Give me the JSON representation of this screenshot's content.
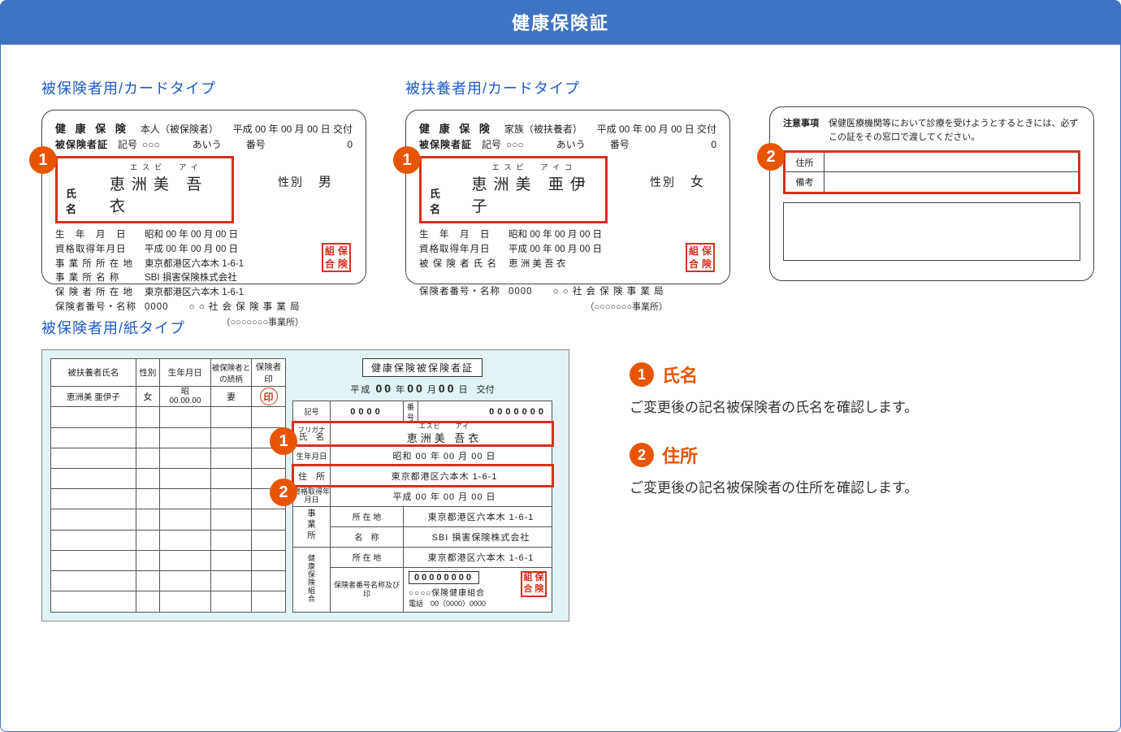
{
  "header": "健康保険証",
  "sec1_label": "被保険者用/カードタイプ",
  "sec2_label": "被扶養者用/カードタイプ",
  "sec3_label": "被保険者用/紙タイプ",
  "card1": {
    "l1_lab": "健 康 保 険",
    "l1_type": "本人（被保険者）",
    "l1_date": "平成 00 年 00 月 00 日 交付",
    "l2_lab": "被保険者証",
    "l2_k1": "記号",
    "l2_v1": "○○○",
    "l2_k2": "あいう",
    "l2_k3": "番号",
    "l2_v3": "0",
    "name_lab": "氏名",
    "furigana": "エスビ　アイ",
    "name": "恵洲美 吾衣",
    "sex_lab": "性別",
    "sex_val": "男",
    "d1l": "生　年　月　日",
    "d1v": "昭和 00 年 00 月 00 日",
    "d2l": "資格取得年月日",
    "d2v": "平成 00 年 00 月 00 日",
    "d3l": "事 業 所 所 在 地",
    "d3v": "東京都港区六本木 1-6-1",
    "d4l": "事 業 所 名 称",
    "d4v": "SBI 損害保険株式会社",
    "d5l": "保 険 者 所 在 地",
    "d5v": "東京都港区六本木 1-6-1",
    "d6l": "保険者番号・名称",
    "d6v": "0000　　○ ○ 社 会 保 険 事 業 局",
    "office": "（○○○○○○○事業所）",
    "seal": [
      "組",
      "保",
      "合",
      "険"
    ]
  },
  "card2": {
    "l1_lab": "健 康 保 険",
    "l1_type": "家族（被扶養者）",
    "l1_date": "平成 00 年 00 月 00 日 交付",
    "l2_lab": "被保険者証",
    "l2_k1": "記号",
    "l2_v1": "○○○",
    "l2_k2": "あいう",
    "l2_k3": "番号",
    "l2_v3": "0",
    "name_lab": "氏名",
    "furigana": "エスビ　アイコ",
    "name": "恵洲美 亜伊子",
    "sex_lab": "性別",
    "sex_val": "女",
    "d1l": "生　年　月　日",
    "d1v": "昭和 00 年 00 月 00 日",
    "d2l": "資格取得年月日",
    "d2v": "平成 00 年 00 月 00 日",
    "d3l": "被 保 険 者 氏 名",
    "d3v": "恵 洲 美  吾 衣",
    "d6l": "保険者番号・名称",
    "d6v": "0000　　○ ○ 社 会 保 険 事 業 局",
    "office": "（○○○○○○○事業所）",
    "seal": [
      "組",
      "保",
      "合",
      "険"
    ]
  },
  "notes": {
    "lab": "注意事項",
    "text": "保健医療機関等において診療を受けようとするときには、必ずこの証をその窓口で渡してください。",
    "addr_lab": "住所",
    "remark_lab": "備考"
  },
  "paper": {
    "dep_headers": [
      "被扶養者氏名",
      "性別",
      "生年月日",
      "被保険者との続柄",
      "保険者印"
    ],
    "dep_row": {
      "name": "恵洲美 亜伊子",
      "sex": "女",
      "dob_era": "昭",
      "dob": "00.00.00",
      "rel": "妻",
      "seal": "印"
    },
    "title": "健康保険被保険者証",
    "date": "平成 00 年 00 月 00 日　交付",
    "kigo_lab": "記号",
    "kigo_val": "0000",
    "bango_lab": "番号",
    "bango_val": "0000000",
    "name_lab": "氏　名",
    "furigana_lab": "フリガナ",
    "furigana": "エスビ　　アイ",
    "name": "恵洲美 吾衣",
    "dob_lab": "生年月日",
    "dob": "昭和 00 年 00 月 00 日",
    "addr_lab": "住　所",
    "addr": "東京都港区六本木 1-6-1",
    "qual_lab": "資格取得年月日",
    "qual": "平成 00 年 00 月 00 日",
    "biz_lab": "事業所",
    "loc_lab": "所 在 地",
    "biz_loc": "東京都港区六本木 1-6-1",
    "bname_lab": "名　称",
    "bname": "SBI 損害保険株式会社",
    "ins_lab": "健康保険組合",
    "ins_loc": "東京都港区六本木 1-6-1",
    "insno_lab": "保険者番号名称及び印",
    "insno": "00000000",
    "insname": "○○○○保険健康組合",
    "tel": "電話　00（0000）0000",
    "seal": [
      "組",
      "保",
      "合",
      "険"
    ]
  },
  "legend": {
    "l1_num": "1",
    "l1_title": "氏名",
    "l1_desc": "ご変更後の記名被保険者の氏名を確認します。",
    "l2_num": "2",
    "l2_title": "住所",
    "l2_desc": "ご変更後の記名被保険者の住所を確認します。"
  }
}
